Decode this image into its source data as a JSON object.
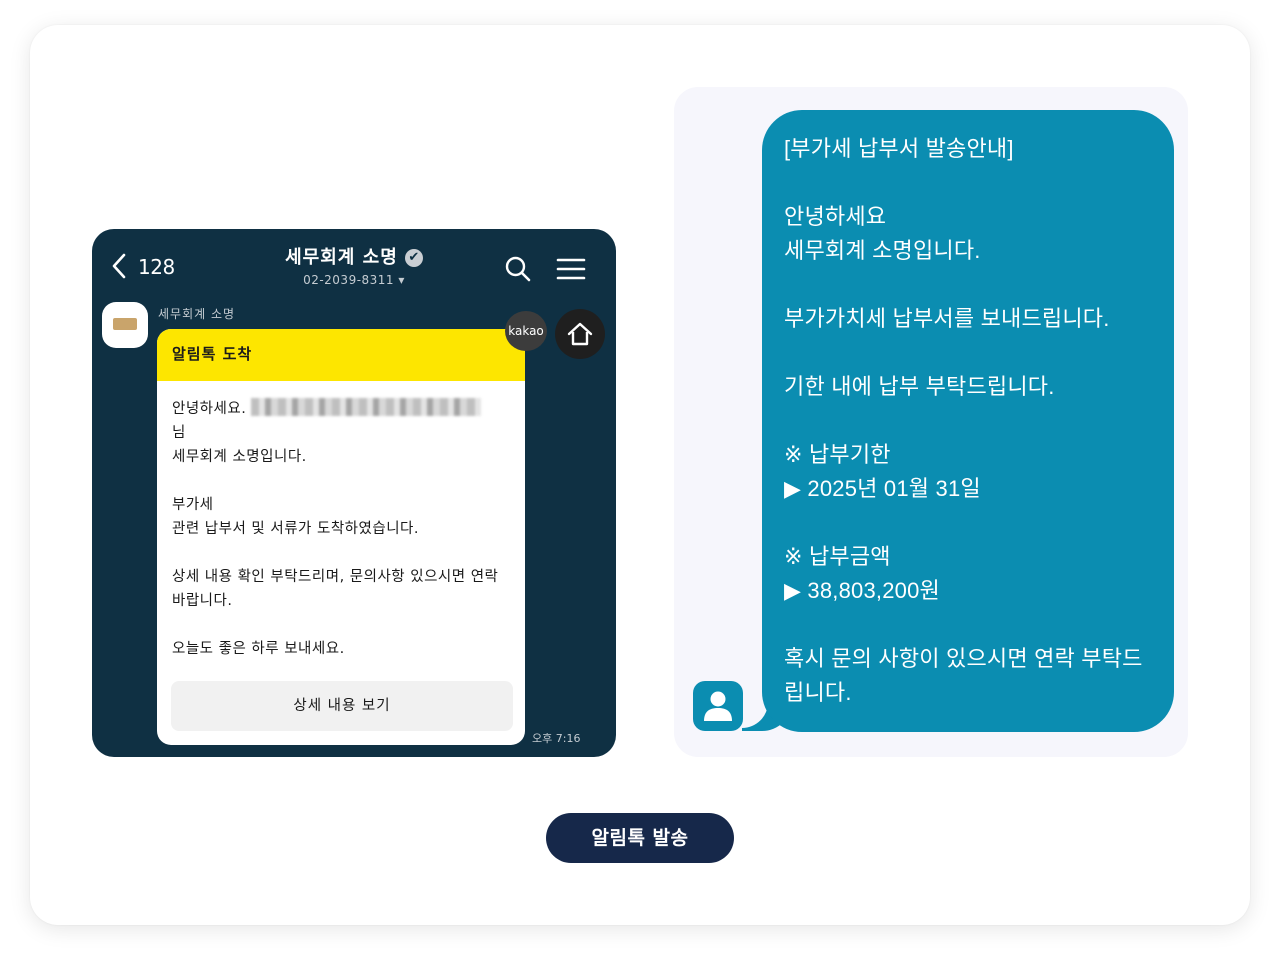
{
  "kakao": {
    "back_count": "128",
    "channel_name": "세무회계 소명",
    "verified_mark": "✔",
    "phone": "02-2039-8311 ▾",
    "sender_label": "세무회계 소명",
    "kakao_badge": "kakao",
    "bubble": {
      "header": "알림톡 도착",
      "greeting": "안녕하세요.",
      "suffix": "님",
      "intro": "세무회계 소명입니다.",
      "line_a": "부가세",
      "line_b": "관련 납부서 및 서류가 도착하였습니다.",
      "line_c": "상세 내용 확인 부탁드리며, 문의사항 있으시면 연락 바랍니다.",
      "line_d": "오늘도 좋은 하루 보내세요.",
      "button": "상세 내용 보기"
    },
    "time": "오후 7:16"
  },
  "sms": {
    "title": "[부가세 납부서 발송안내]",
    "greeting": "안녕하세요",
    "intro": "세무회계 소명입니다.",
    "notice": "부가가치세 납부서를 보내드립니다.",
    "request": "기한 내에 납부 부탁드립니다.",
    "deadline_label": "※ 납부기한",
    "deadline_value": "▶ 2025년 01월 31일",
    "amount_label": "※ 납부금액",
    "amount_value": "▶ 38,803,200원",
    "closing": "혹시 문의 사항이 있으시면 연락 부탁드립니다."
  },
  "send_button": "알림톡 발송",
  "colors": {
    "kakao_bg": "#0f3043",
    "kakao_yellow": "#fde600",
    "sms_blue": "#0b8db1",
    "button_navy": "#16284a"
  },
  "icons": [
    "back-chevron-icon",
    "verified-icon",
    "search-icon",
    "menu-icon",
    "home-icon",
    "user-icon"
  ]
}
